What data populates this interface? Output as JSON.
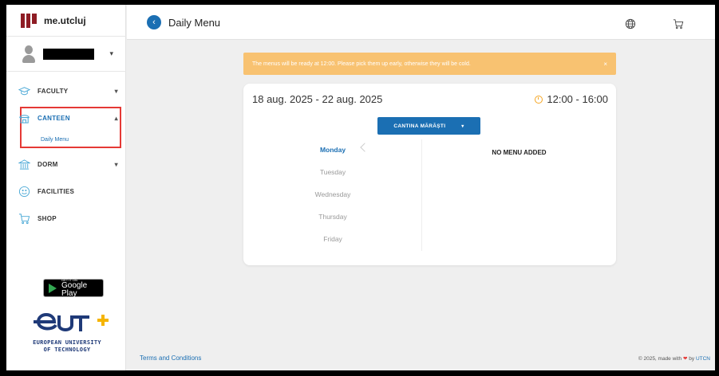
{
  "brand": {
    "name": "me.utcluj"
  },
  "header": {
    "title": "Daily Menu"
  },
  "nav": {
    "faculty": "FACULTY",
    "canteen": "CANTEEN",
    "canteen_sub": "Daily Menu",
    "dorm": "DORM",
    "facilities": "FACILITIES",
    "shop": "SHOP"
  },
  "store": {
    "small": "GET IT ON",
    "big": "Google Play"
  },
  "eut": {
    "line1": "EUROPEAN UNIVERSITY",
    "line2": "OF TECHNOLOGY"
  },
  "banner": {
    "text": "The menus will be ready at 12:00. Please pick them up early, otherwise they will be cold.",
    "close": "×"
  },
  "menu": {
    "dates": "18 aug. 2025 - 22 aug. 2025",
    "hours": "12:00 - 16:00",
    "location": "CANTINA MĂRĂȘTI",
    "days": [
      "Monday",
      "Tuesday",
      "Wednesday",
      "Thursday",
      "Friday"
    ],
    "active_day": "Monday",
    "empty": "NO MENU ADDED"
  },
  "footer": {
    "terms": "Terms and Conditions",
    "made_prefix": "© 2025, made with",
    "made_by": "by",
    "made_org": "UTCN"
  },
  "colors": {
    "accent": "#1b6fb3",
    "warning": "#f8c271",
    "highlight": "#e53935",
    "brand": "#8e1c24"
  }
}
